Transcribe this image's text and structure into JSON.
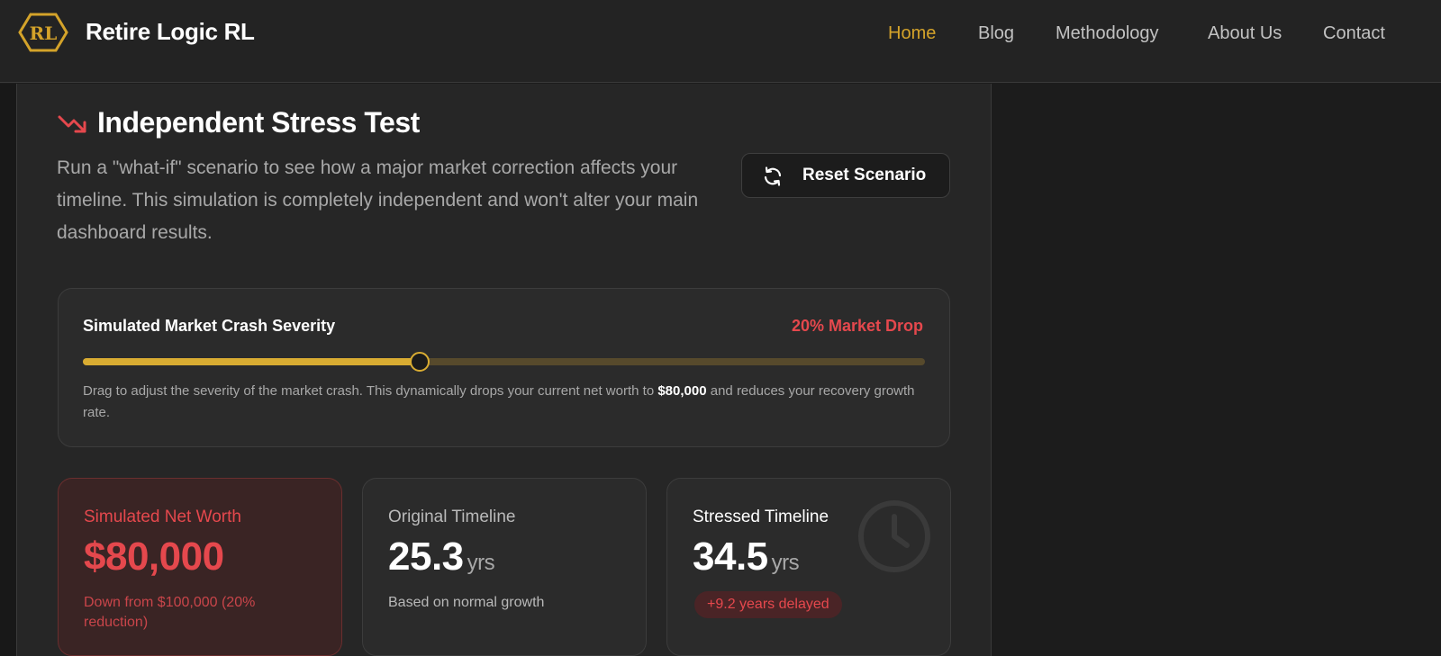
{
  "header": {
    "logo_text": "RL",
    "brand": "Retire Logic RL",
    "nav": [
      {
        "label": "Home",
        "active": true
      },
      {
        "label": "Blog",
        "active": false
      },
      {
        "label": "Methodology",
        "active": false
      },
      {
        "label": "About Us",
        "active": false
      },
      {
        "label": "Contact",
        "active": false
      }
    ]
  },
  "stress_test": {
    "title_icon": "trending-down-icon",
    "title": "Independent Stress Test",
    "description": "Run a \"what-if\" scenario to see how a major market correction affects your timeline. This simulation is completely independent and won't alter your main dashboard results.",
    "reset_button": {
      "label": "Reset Scenario",
      "icon": "refresh-icon"
    },
    "slider": {
      "label": "Simulated Market Crash Severity",
      "value_text": "20% Market Drop",
      "position_fraction": 0.4,
      "help_prefix": "Drag to adjust the severity of the market crash. This dynamically drops your current net worth to ",
      "help_bold": "$80,000",
      "help_suffix": " and reduces your recovery growth rate."
    },
    "cards": {
      "net_worth": {
        "label": "Simulated Net Worth",
        "value": "$80,000",
        "sub": "Down from $100,000 (20% reduction)"
      },
      "original": {
        "label": "Original Timeline",
        "value": "25.3",
        "unit": "yrs",
        "sub": "Based on normal growth"
      },
      "stressed": {
        "label": "Stressed Timeline",
        "value": "34.5",
        "unit": "yrs",
        "badge": "+9.2 years delayed",
        "icon": "clock-icon"
      }
    }
  },
  "colors": {
    "accent_gold": "#d4a32a",
    "danger_red": "#e5484d",
    "background": "#1c1c1c",
    "panel": "#262626"
  }
}
